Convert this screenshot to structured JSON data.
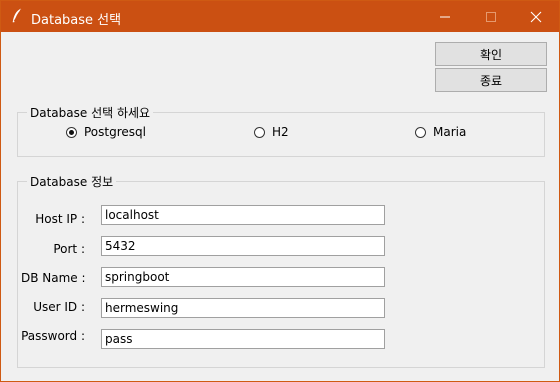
{
  "window": {
    "title": "Database 선택",
    "title_bar_color": "#cb5012",
    "icon": "feather-icon"
  },
  "buttons": {
    "confirm_label": "확인",
    "exit_label": "종료"
  },
  "db_select": {
    "legend": "Database 선택 하세요",
    "options": [
      {
        "label": "Postgresql",
        "selected": true
      },
      {
        "label": "H2",
        "selected": false
      },
      {
        "label": "Maria",
        "selected": false
      }
    ]
  },
  "db_info": {
    "legend": "Database 정보",
    "fields": [
      {
        "label": "Host IP :",
        "value": "localhost"
      },
      {
        "label": "Port :",
        "value": "5432"
      },
      {
        "label": "DB Name :",
        "value": "springboot"
      },
      {
        "label": "User ID :",
        "value": "hermeswing"
      },
      {
        "label": "Password :",
        "value": "pass"
      }
    ]
  }
}
